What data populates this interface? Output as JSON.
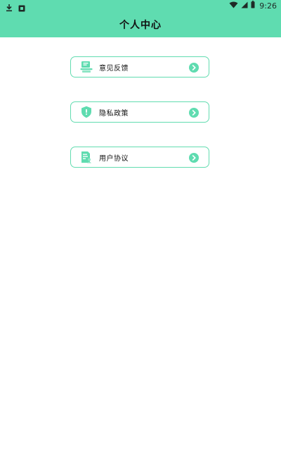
{
  "status_bar": {
    "time": "9:26",
    "left_icons": [
      "download-icon",
      "notification-app-icon"
    ],
    "right_icons": [
      "wifi-icon",
      "signal-icon",
      "battery-icon"
    ]
  },
  "header": {
    "title": "个人中心",
    "background_color": "#5fdcb0"
  },
  "menu": {
    "items": [
      {
        "label": "意见反馈",
        "icon": "feedback-icon"
      },
      {
        "label": "隐私政策",
        "icon": "privacy-shield-icon"
      },
      {
        "label": "用户协议",
        "icon": "user-agreement-icon"
      }
    ],
    "accent_color": "#62dcb0"
  }
}
